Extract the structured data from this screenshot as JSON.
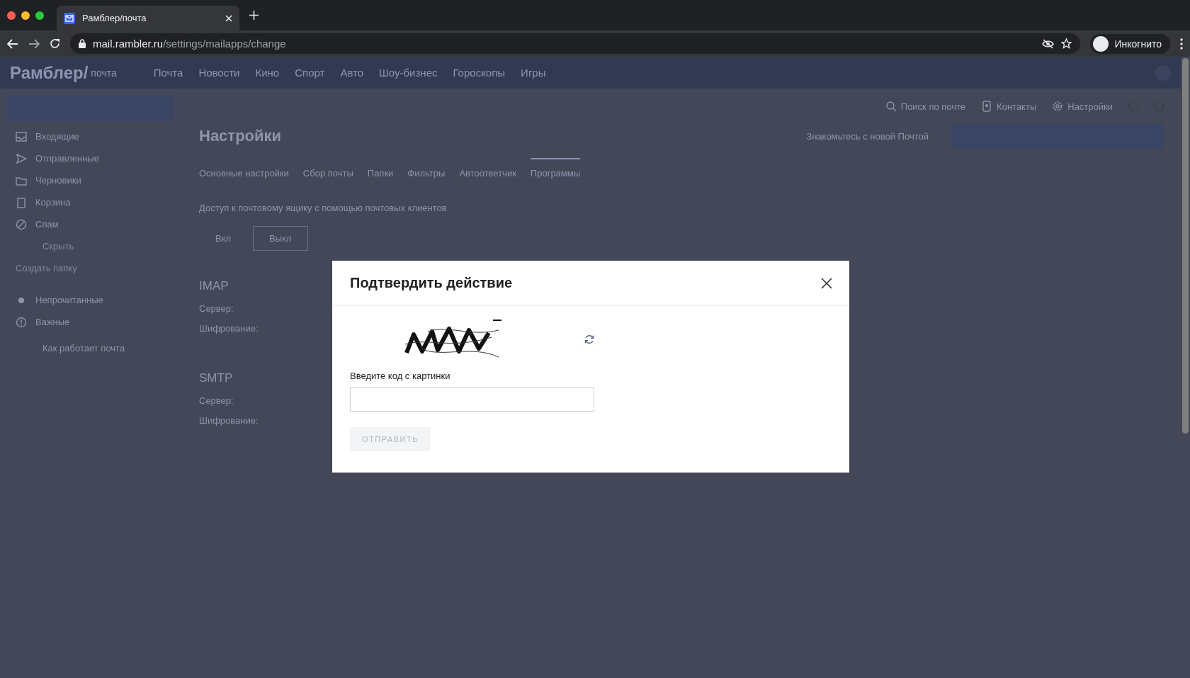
{
  "browser": {
    "tab_title": "Рамблер/почта",
    "url_host": "mail.rambler.ru",
    "url_path": "/settings/mailapps/change",
    "profile_label": "Инкогнито"
  },
  "header": {
    "logo": "Рамблер/",
    "logo_sub": "почта",
    "nav": [
      "Почта",
      "Новости",
      "Кино",
      "Спорт",
      "Авто",
      "Шоу-бизнес",
      "Гороскопы",
      "Игры"
    ]
  },
  "toolbar": [
    {
      "kind": "search",
      "label": "Поиск по почте"
    },
    {
      "kind": "contacts",
      "label": "Контакты"
    },
    {
      "kind": "settings",
      "label": "Настройки"
    }
  ],
  "promo": "Знакомьтесь с новой Почтой",
  "sidebar": {
    "folders": [
      {
        "kind": "inbox",
        "label": "Входящие"
      },
      {
        "kind": "sent",
        "label": "Отправленные"
      },
      {
        "kind": "drafts",
        "label": "Черновики"
      },
      {
        "kind": "trash",
        "label": "Корзина"
      },
      {
        "kind": "spam",
        "label": "Спам"
      }
    ],
    "hide": "Скрыть",
    "create": "Создать папку",
    "filters": [
      {
        "kind": "unread",
        "label": "Непрочитанные"
      },
      {
        "kind": "important",
        "label": "Важные"
      }
    ],
    "help": "Как работает почта"
  },
  "settings": {
    "title": "Настройки",
    "tabs": [
      {
        "label": "Основные настройки",
        "selected": false
      },
      {
        "label": "Сбор почты",
        "selected": false
      },
      {
        "label": "Папки",
        "selected": false
      },
      {
        "label": "Фильтры",
        "selected": false
      },
      {
        "label": "Автоответчик",
        "selected": false
      },
      {
        "label": "Программы",
        "selected": true
      }
    ],
    "description": "Доступ к почтовому ящику с помощью почтовых клиентов",
    "toggle": [
      {
        "label": "Вкл",
        "selected": false
      },
      {
        "label": "Выкл",
        "selected": true
      }
    ],
    "sections": [
      {
        "title": "IMAP",
        "rows": [
          "Сервер:",
          "Шифрование:"
        ]
      },
      {
        "title": "SMTP",
        "rows": [
          "Сервер:",
          "Шифрование:"
        ]
      }
    ]
  },
  "modal": {
    "title": "Подтвердить действие",
    "label": "Введите код с картинки",
    "submit": "ОТПРАВИТЬ",
    "submit_disabled": true
  }
}
